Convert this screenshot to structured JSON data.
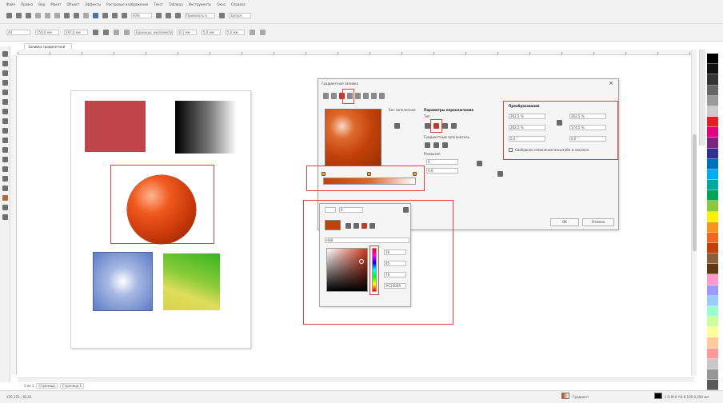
{
  "menu": {
    "items": [
      "Файл",
      "Правка",
      "Вид",
      "Макет",
      "Объект",
      "Эффекты",
      "Растровые изображения",
      "Текст",
      "Таблица",
      "Инструменты",
      "Окно",
      "Справка"
    ]
  },
  "toolbar": {
    "zoom": "93%",
    "snap_label": "Привязать к",
    "launch_label": "Запуск",
    "size_w": "150,0 мм",
    "size_h": "297,0 мм",
    "units": "Единицы: миллиметры",
    "nudge": "0,1 мм",
    "dup_x": "5,0 мм",
    "dup_y": "5,0 мм"
  },
  "document": {
    "tab_title": "Заливка градиентной"
  },
  "dialog": {
    "title": "Градиентная заливка",
    "close": "×",
    "fill_label": "Без заполнения",
    "mode_header": "Параметры переключения",
    "type_label": "Тип",
    "smooth_label": "Градиентный заполнитель",
    "transform_header": "Преобразования",
    "x_value": "262,5 %",
    "y_value": "262,5 %",
    "w_value": "262,5 %",
    "h_value": "174,5 %",
    "angle_value": "0,0 °",
    "skew_value": "0,0 °",
    "free_scale_label": "Свободное изменение масштаба и наклона",
    "blend_label": "Размытие",
    "steps_label": "0",
    "acceleration_label": "0,0",
    "ok": "OK",
    "cancel": "Отмена"
  },
  "gradient_bar": {
    "start_color": "#c2400a",
    "end_color": "#ffffff",
    "node_positions_percent": [
      0,
      50,
      100
    ]
  },
  "color_popup": {
    "hex_value": "#C2400A",
    "model_label": "HSB",
    "h": "16",
    "s": "95",
    "b": "76",
    "alpha": "0"
  },
  "page_tabs": {
    "current": "1 из 1",
    "page1": "Страница",
    "page2": "Страница 1"
  },
  "status": {
    "left": "125,125 ; 82,01",
    "fill_label": "Градиент",
    "outline": "C:0 M:0 Y:0 K:100 0,200 мм"
  },
  "colors": {
    "highlight": "#d9423f",
    "accent": "#c2400a"
  },
  "palette": [
    "#ffffff",
    "#000000",
    "#111111",
    "#333333",
    "#666666",
    "#999999",
    "#cccccc",
    "#e31e24",
    "#e6007e",
    "#7b2481",
    "#2e3192",
    "#0072bc",
    "#00aeef",
    "#00a99d",
    "#00a651",
    "#8dc63f",
    "#fff200",
    "#f7941d",
    "#f26522",
    "#c2400a",
    "#8b5e3c",
    "#603913",
    "#ff99cc",
    "#9999ff",
    "#99ccff",
    "#99ffcc",
    "#ccff99",
    "#ffff99",
    "#ffcc99",
    "#ff9999",
    "#c8c8c8",
    "#969696",
    "#5a5a5a"
  ]
}
